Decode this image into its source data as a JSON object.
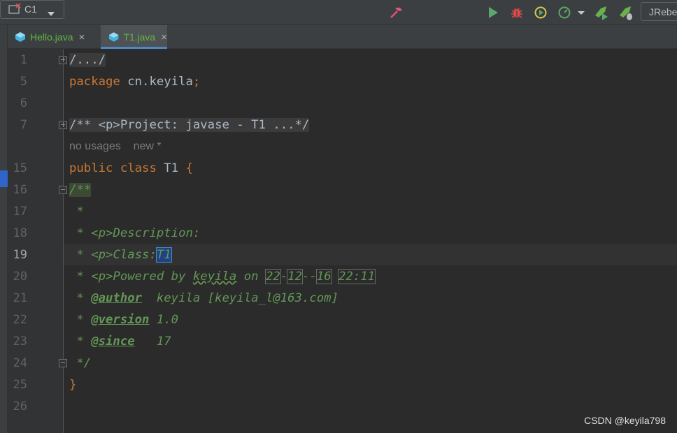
{
  "toolbar": {
    "run_config_label": "C1",
    "jrebel_label": "JRebel",
    "colors": {
      "run": "#59a869",
      "debug": "#e04a4a",
      "coverage": "#d9c84e",
      "hammer": "#e2547a"
    },
    "icons": [
      "hammer-icon",
      "run-config-icon",
      "dropdown-arrow-icon",
      "run-icon",
      "debug-icon",
      "coverage-icon",
      "profiler-icon",
      "jrebel-run-icon",
      "jrebel-debug-icon"
    ]
  },
  "tabs": [
    {
      "label": "Hello.java",
      "close": "×",
      "active": false
    },
    {
      "label": "T1.java",
      "close": "×",
      "active": true
    }
  ],
  "editor": {
    "line_numbers": [
      "1",
      "5",
      "6",
      "7",
      "15",
      "16",
      "17",
      "18",
      "19",
      "20",
      "21",
      "22",
      "23",
      "24",
      "25",
      "26"
    ],
    "current_line": "19",
    "inlay_hint": "no usages    new *",
    "lines": {
      "l1": "/.../",
      "l5_kw": "package",
      "l5_pkg": " cn.keyila",
      "l5_semi": ";",
      "l7": "/** <p>Project: javase - T1 ...*/",
      "l15_kw": "public class",
      "l15_name": " T1 ",
      "l15_brace": "{",
      "l16": "/**",
      "l17": " *",
      "l18_prefix": " * ",
      "l18_tag": "<p>",
      "l18_text": "Description:",
      "l19_prefix": " * ",
      "l19_tag": "<p>",
      "l19_text": "Class:",
      "l19_sel": "T1",
      "l20_prefix": " * ",
      "l20_tag": "<p>",
      "l20_text1": "Powered by ",
      "l20_name": "keyila",
      "l20_text2": " on ",
      "l20_d1": "22",
      "l20_s1": "-",
      "l20_d2": "12",
      "l20_s2": "--",
      "l20_d3": "16",
      "l20_sp": " ",
      "l20_time": "22:11",
      "l21_prefix": " * ",
      "l21_tag": "@author",
      "l21_text": "  keyila [keyila_l@163.com]",
      "l22_prefix": " * ",
      "l22_tag": "@version",
      "l22_text": " 1.0",
      "l23_prefix": " * ",
      "l23_tag": "@since",
      "l23_text": "   17",
      "l24": " */",
      "l25": "}"
    }
  },
  "watermark": "CSDN @keyila798"
}
